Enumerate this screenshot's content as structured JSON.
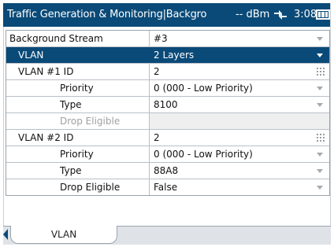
{
  "status_bar": {
    "title": "Traffic Generation  &  Monitoring|Backgro",
    "signal": "-- dBm",
    "time": "3:08",
    "usb_icon": "usb-connection-icon",
    "battery_icon": "battery-full-icon"
  },
  "rows": [
    {
      "label": "Background Stream",
      "value": "#3"
    },
    {
      "label": "VLAN",
      "value": "2 Layers"
    },
    {
      "label": "VLAN #1 ID",
      "value": "2"
    },
    {
      "label": "Priority",
      "value": "0 (000 - Low Priority)"
    },
    {
      "label": "Type",
      "value": "8100"
    },
    {
      "label": "Drop Eligible",
      "value": ""
    },
    {
      "label": "VLAN #2 ID",
      "value": "2"
    },
    {
      "label": "Priority",
      "value": "0 (000 - Low Priority)"
    },
    {
      "label": "Type",
      "value": "88A8"
    },
    {
      "label": "Drop Eligible",
      "value": "False"
    }
  ],
  "tabs": [
    {
      "label": "VLAN"
    }
  ],
  "colors": {
    "accent": "#0a4a78",
    "disabled_text": "#a0a0a0"
  }
}
